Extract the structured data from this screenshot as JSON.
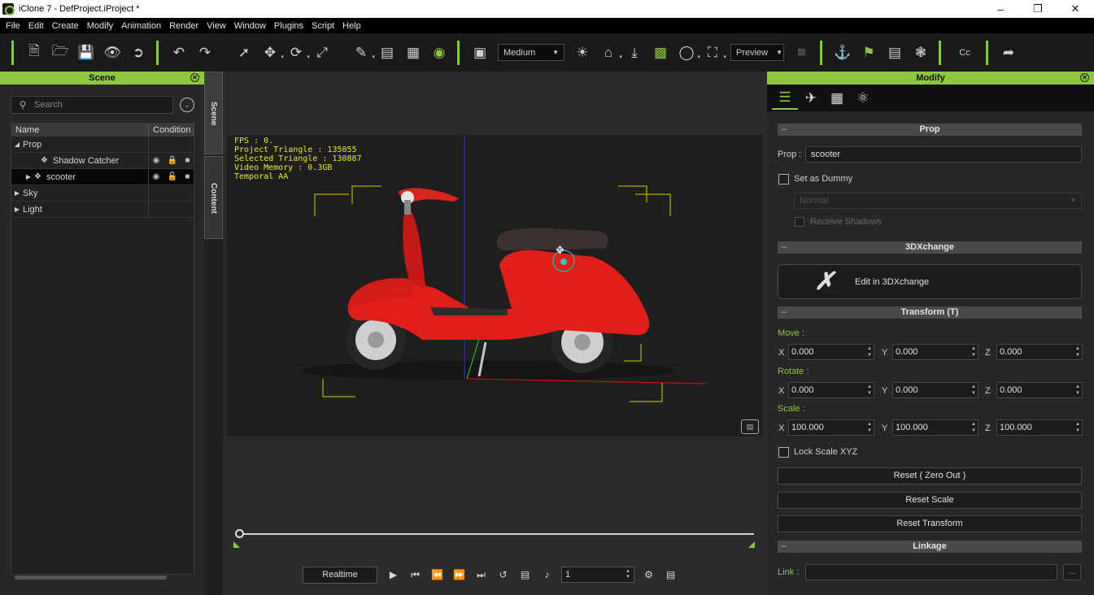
{
  "window": {
    "title": "iClone 7 - DefProject.iProject *"
  },
  "menu": [
    "File",
    "Edit",
    "Create",
    "Modify",
    "Animation",
    "Render",
    "View",
    "Window",
    "Plugins",
    "Script",
    "Help"
  ],
  "toolbar": {
    "quality": "Medium",
    "preview": "Preview",
    "cc_label": "Cc"
  },
  "scene_panel": {
    "title": "Scene",
    "search_placeholder": "Search",
    "columns": [
      "Name",
      "Condition"
    ],
    "rows": [
      {
        "label": "Prop",
        "level": 0,
        "expanded": true
      },
      {
        "label": "Shadow Catcher",
        "level": 1
      },
      {
        "label": "scooter",
        "level": 1,
        "selected": true
      },
      {
        "label": "Sky",
        "level": 0
      },
      {
        "label": "Light",
        "level": 0
      }
    ]
  },
  "side_tabs": [
    "Scene",
    "Content"
  ],
  "viewport": {
    "fps": "FPS : 0.",
    "project_triangle": "Project Triangle : 135055",
    "selected_triangle": "Selected Triangle : 130887",
    "video_memory": "Video Memory : 0.3GB",
    "temporal_aa": "Temporal AA"
  },
  "playback": {
    "mode": "Realtime",
    "frame": "1"
  },
  "modify_panel": {
    "title": "Modify",
    "prop_section": "Prop",
    "prop_label": "Prop :",
    "prop_name": "scooter",
    "dummy_label": "Set as Dummy",
    "normal_option": "Normal",
    "receive_shadows": "Receive Shadows",
    "threedx_section": "3DXchange",
    "edit_3dx": "Edit in 3DXchange",
    "transform_section": "Transform (T)",
    "move_label": "Move :",
    "rotate_label": "Rotate :",
    "scale_label": "Scale :",
    "axes": [
      "X",
      "Y",
      "Z"
    ],
    "move": [
      "0.000",
      "0.000",
      "0.000"
    ],
    "rotate": [
      "0.000",
      "0.000",
      "0.000"
    ],
    "scale": [
      "100.000",
      "100.000",
      "100.000"
    ],
    "lock_scale": "Lock Scale XYZ",
    "reset_zero": "Reset ( Zero Out )",
    "reset_scale": "Reset Scale",
    "reset_transform": "Reset Transform",
    "linkage_section": "Linkage",
    "link_label": "Link :",
    "link_more": "..."
  },
  "colors": {
    "accent": "#8dc63f",
    "stats_text": "#e8f000",
    "scooter_red": "#e01f1a"
  }
}
